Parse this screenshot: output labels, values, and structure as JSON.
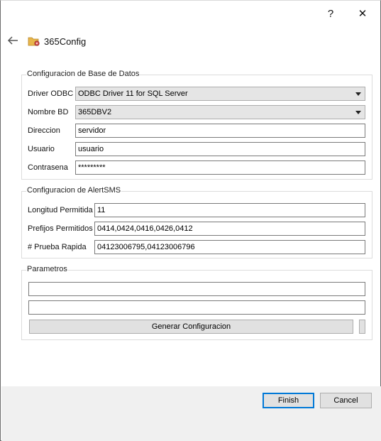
{
  "window": {
    "help_glyph": "?",
    "close_glyph": "✕",
    "title": "365Config"
  },
  "db_group": {
    "title": "Configuracion de Base de Datos",
    "driver_label": "Driver ODBC",
    "driver_value": "ODBC Driver 11 for SQL Server",
    "db_label": "Nombre BD",
    "db_value": "365DBV2",
    "address_label": "Direccion",
    "address_value": "servidor",
    "user_label": "Usuario",
    "user_value": "usuario",
    "password_label": "Contrasena",
    "password_value": "*********"
  },
  "sms_group": {
    "title": "Configuracion de AlertSMS",
    "length_label": "Longitud Permitida",
    "length_value": "11",
    "prefix_label": "Prefijos Permitidos",
    "prefix_value": "0414,0424,0416,0426,0412",
    "test_label": "# Prueba Rapida",
    "test_value": "04123006795,04123006796"
  },
  "params_group": {
    "title": "Parametros",
    "field1_value": "",
    "field2_value": "",
    "generate_label": "Generar Configuracion"
  },
  "footer": {
    "finish_label": "Finish",
    "cancel_label": "Cancel"
  },
  "colors": {
    "accent": "#0078d7",
    "footer_bg": "#f0f0f0",
    "combo_bg": "#e5e5e5"
  }
}
